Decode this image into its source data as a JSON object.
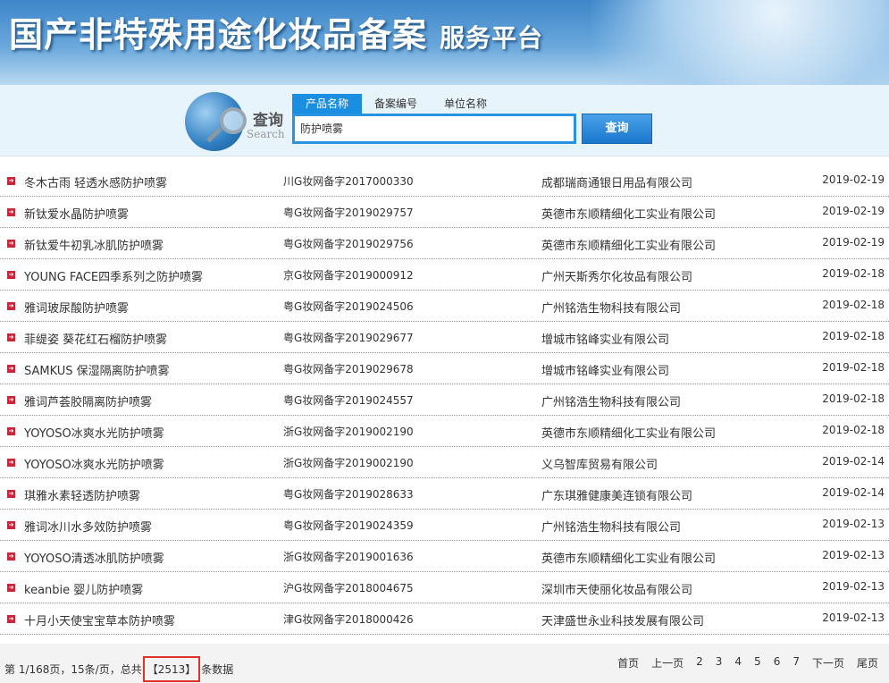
{
  "header": {
    "title": "国产非特殊用途化妆品备案",
    "subtitle": "服务平台"
  },
  "search": {
    "logo_cn": "查询",
    "logo_en": "Search",
    "tabs": [
      "产品名称",
      "备案编号",
      "单位名称"
    ],
    "active_tab": 0,
    "query": "防护喷雾",
    "button": "查询"
  },
  "rows": [
    [
      "冬木古雨 轻透水感防护喷雾",
      "川G妆网备字2017000330",
      "成都瑞商通银日用品有限公司",
      "2019-02-19"
    ],
    [
      "新钛爱水晶防护喷雾",
      "粤G妆网备字2019029757",
      "英德市东顺精细化工实业有限公司",
      "2019-02-19"
    ],
    [
      "新钛爱牛初乳冰肌防护喷雾",
      "粤G妆网备字2019029756",
      "英德市东顺精细化工实业有限公司",
      "2019-02-19"
    ],
    [
      "YOUNG FACE四季系列之防护喷雾",
      "京G妆网备字2019000912",
      "广州天斯秀尔化妆品有限公司",
      "2019-02-18"
    ],
    [
      "雅词玻尿酸防护喷雾",
      "粤G妆网备字2019024506",
      "广州铭浩生物科技有限公司",
      "2019-02-18"
    ],
    [
      "菲缇姿 葵花红石榴防护喷雾",
      "粤G妆网备字2019029677",
      "增城市铭峰实业有限公司",
      "2019-02-18"
    ],
    [
      "SAMKUS 保湿隔离防护喷雾",
      "粤G妆网备字2019029678",
      "增城市铭峰实业有限公司",
      "2019-02-18"
    ],
    [
      "雅词芦荟胶隔离防护喷雾",
      "粤G妆网备字2019024557",
      "广州铭浩生物科技有限公司",
      "2019-02-18"
    ],
    [
      "YOYOSO冰爽水光防护喷雾",
      "浙G妆网备字2019002190",
      "英德市东顺精细化工实业有限公司",
      "2019-02-18"
    ],
    [
      "YOYOSO冰爽水光防护喷雾",
      "浙G妆网备字2019002190",
      "义乌智库贸易有限公司",
      "2019-02-14"
    ],
    [
      "琪雅水素轻透防护喷雾",
      "粤G妆网备字2019028633",
      "广东琪雅健康美连锁有限公司",
      "2019-02-14"
    ],
    [
      "雅词冰川水多效防护喷雾",
      "粤G妆网备字2019024359",
      "广州铭浩生物科技有限公司",
      "2019-02-13"
    ],
    [
      "YOYOSO清透冰肌防护喷雾",
      "浙G妆网备字2019001636",
      "英德市东顺精细化工实业有限公司",
      "2019-02-13"
    ],
    [
      "keanbie 婴儿防护喷雾",
      "沪G妆网备字2018004675",
      "深圳市天使丽化妆品有限公司",
      "2019-02-13"
    ],
    [
      "十月小天使宝宝草本防护喷雾",
      "津G妆网备字2018000426",
      "天津盛世永业科技发展有限公司",
      "2019-02-13"
    ]
  ],
  "footer": {
    "info_prefix": "第 1/168页，15条/页，总共",
    "count": "【2513】",
    "info_suffix": "条数据",
    "pager": [
      "首页",
      "上一页",
      "2",
      "3",
      "4",
      "5",
      "6",
      "7",
      "下一页",
      "尾页"
    ]
  },
  "colors": {
    "accent": "#1a8ee0",
    "bullet": "#c9283a",
    "highlight": "#e0302a"
  }
}
